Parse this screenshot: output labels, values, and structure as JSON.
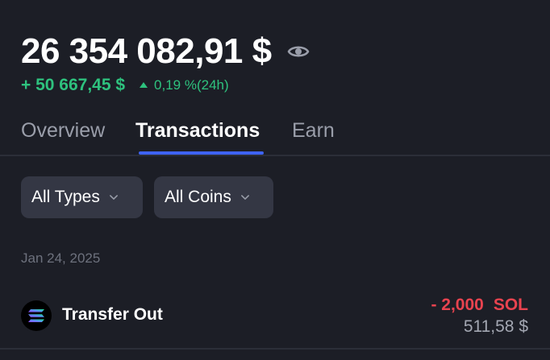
{
  "balance": {
    "total": "26 354 082,91 $",
    "visibility_icon": "eye-icon",
    "change_amount": "+ 50 667,45 $",
    "change_percent": "0,19 %(24h)",
    "change_direction_icon": "triangle-up-icon"
  },
  "tabs": [
    {
      "label": "Overview",
      "active": false
    },
    {
      "label": "Transactions",
      "active": true
    },
    {
      "label": "Earn",
      "active": false
    }
  ],
  "filters": {
    "types": {
      "label": "All Types",
      "icon": "chevron-down-icon"
    },
    "coins": {
      "label": "All Coins",
      "icon": "chevron-down-icon"
    }
  },
  "transactions": {
    "groups": [
      {
        "date": "Jan 24, 2025",
        "items": [
          {
            "title": "Transfer Out",
            "coin_icon": "solana-icon",
            "amount": "- 2,000",
            "symbol": "SOL",
            "fiat": "511,58 $"
          }
        ]
      }
    ]
  },
  "colors": {
    "background": "#1c1e26",
    "positive": "#2ec27e",
    "negative": "#e8434f",
    "accent": "#3e63f2",
    "chip": "#343744"
  }
}
